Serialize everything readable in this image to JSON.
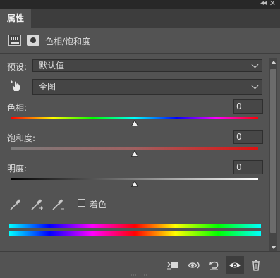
{
  "panel": {
    "tab_label": "属性",
    "adjustment_title": "色相/饱和度",
    "icons": {
      "collapse": "double-chevron-icon",
      "close": "close-icon",
      "menu": "panel-menu-icon",
      "adjustment": "hue-saturation-layer-icon",
      "mask": "mask-icon"
    }
  },
  "preset": {
    "label": "预设:",
    "value": "默认值"
  },
  "channel": {
    "value": "全图",
    "tool_icon": "on-image-adjust-hand-icon"
  },
  "sliders": [
    {
      "id": "hue",
      "label": "色相:",
      "value": "0",
      "min": -180,
      "max": 180,
      "position": 0.5
    },
    {
      "id": "saturation",
      "label": "饱和度:",
      "value": "0",
      "min": -100,
      "max": 100,
      "position": 0.5
    },
    {
      "id": "lightness",
      "label": "明度:",
      "value": "0",
      "min": -100,
      "max": 100,
      "position": 0.5
    }
  ],
  "colorize": {
    "label": "着色",
    "checked": false
  },
  "eyedroppers": [
    "eyedropper-icon",
    "eyedropper-add-icon",
    "eyedropper-subtract-icon"
  ],
  "footer_buttons": [
    {
      "name": "clip-to-layer-button",
      "icon": "clip-icon"
    },
    {
      "name": "view-previous-button",
      "icon": "eye-previous-icon"
    },
    {
      "name": "reset-button",
      "icon": "reset-icon"
    },
    {
      "name": "toggle-visibility-button",
      "icon": "eye-icon",
      "active": true
    },
    {
      "name": "delete-button",
      "icon": "trash-icon"
    }
  ],
  "colors": {
    "panel_bg": "#535353",
    "tab_bar": "#3d3d3d",
    "title_bar": "#282828",
    "accent_text": "#dcdcdc"
  }
}
